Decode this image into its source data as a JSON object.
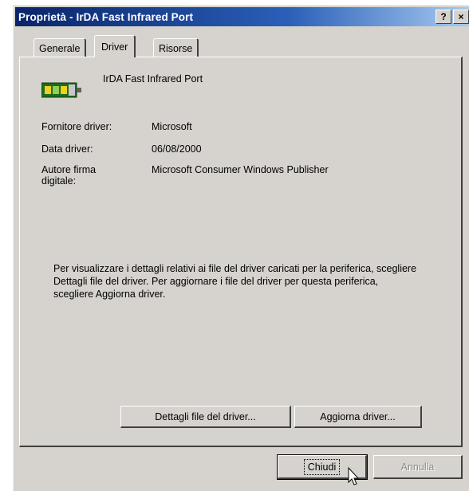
{
  "window": {
    "title": "Proprietà - IrDA Fast Infrared Port",
    "help_button": "?",
    "close_button": "×"
  },
  "tabs": [
    {
      "label": "Generale",
      "active": false
    },
    {
      "label": "Driver",
      "active": true
    },
    {
      "label": "Risorse",
      "active": false
    }
  ],
  "device": {
    "name": "IrDA Fast Infrared Port",
    "icon": "infrared-port-icon"
  },
  "details": {
    "provider_label": "Fornitore driver:",
    "provider_value": "Microsoft",
    "date_label": "Data driver:",
    "date_value": "06/08/2000",
    "signer_label": "Autore firma digitale:",
    "signer_value": "Microsoft Consumer Windows Publisher"
  },
  "description": "Per visualizzare i dettagli relativi ai file del driver caricati per la periferica, scegliere Dettagli file del driver. Per aggiornare i file del driver per questa periferica, scegliere Aggiorna driver.",
  "buttons": {
    "details": "Dettagli file del driver...",
    "update": "Aggiorna driver...",
    "close": "Chiudi",
    "cancel": "Annulla"
  },
  "colors": {
    "titlebar_start": "#0a246a",
    "face": "#d6d3ce"
  }
}
